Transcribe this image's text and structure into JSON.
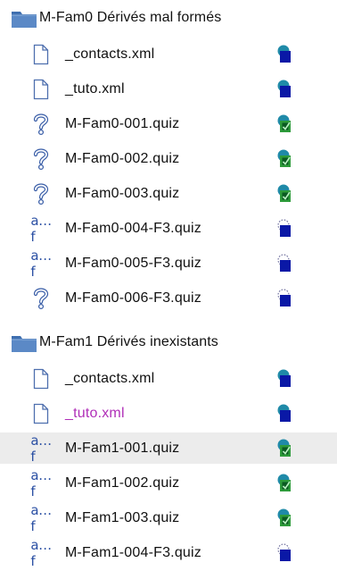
{
  "groups": [
    {
      "folder": "M-Fam0 Dérivés mal formés",
      "items": [
        {
          "name": "_contacts.xml",
          "icon": "document-icon",
          "status": "status-saved-icon",
          "color": "default"
        },
        {
          "name": "_tuto.xml",
          "icon": "document-icon",
          "status": "status-saved-icon",
          "color": "default"
        },
        {
          "name": "M-Fam0-001.quiz",
          "icon": "question-mark-icon",
          "status": "status-checked-icon",
          "color": "default"
        },
        {
          "name": "M-Fam0-002.quiz",
          "icon": "question-mark-icon",
          "status": "status-checked-icon",
          "color": "default"
        },
        {
          "name": "M-Fam0-003.quiz",
          "icon": "question-mark-icon",
          "status": "status-checked-icon",
          "color": "default"
        },
        {
          "name": "M-Fam0-004-F3.quiz",
          "icon": "af-file-icon",
          "status": "status-pending-icon",
          "color": "default"
        },
        {
          "name": "M-Fam0-005-F3.quiz",
          "icon": "af-file-icon",
          "status": "status-pending-icon",
          "color": "default"
        },
        {
          "name": "M-Fam0-006-F3.quiz",
          "icon": "question-mark-icon",
          "status": "status-pending-icon",
          "color": "default"
        }
      ]
    },
    {
      "folder": "M-Fam1 Dérivés inexistants",
      "items": [
        {
          "name": "_contacts.xml",
          "icon": "document-icon",
          "status": "status-saved-icon",
          "color": "default"
        },
        {
          "name": "_tuto.xml",
          "icon": "document-icon",
          "status": "status-saved-icon",
          "color": "#b02fb8"
        },
        {
          "name": "M-Fam1-001.quiz",
          "icon": "af-file-icon",
          "status": "status-checked-icon",
          "color": "default",
          "selected": true
        },
        {
          "name": "M-Fam1-002.quiz",
          "icon": "af-file-icon",
          "status": "status-checked-icon",
          "color": "default"
        },
        {
          "name": "M-Fam1-003.quiz",
          "icon": "af-file-icon",
          "status": "status-checked-icon",
          "color": "default"
        },
        {
          "name": "M-Fam1-004-F3.quiz",
          "icon": "af-file-icon",
          "status": "status-pending-icon",
          "color": "default"
        }
      ]
    }
  ],
  "af_glyph": "a…f",
  "colors": {
    "status_blue": "#0a18a6",
    "status_teal": "#1f8aa8",
    "status_green": "#2d9b3a",
    "folder_blue": "#5b89c6",
    "magenta_text": "#b02fb8"
  }
}
